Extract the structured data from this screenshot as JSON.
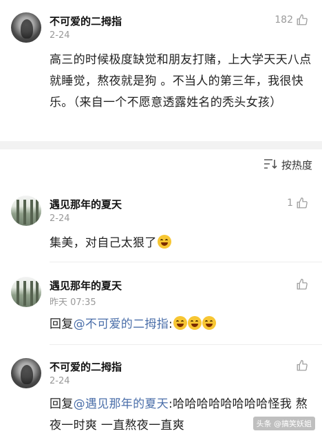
{
  "post": {
    "author": "不可爱的二拇指",
    "date": "2-24",
    "likes": "182",
    "content": "高三的时候极度缺觉和朋友打赌，上大学天天八点就睡觉，熬夜就是狗 。不当人的第三年，我很快乐。（来自一个不愿意透露姓名的秃头女孩）"
  },
  "sort": {
    "label": "按热度",
    "icon": "sort-icon"
  },
  "comments": [
    {
      "author": "遇见那年的夏天",
      "date": "2-24",
      "likes": "1",
      "text": "集美，对自己太狠了",
      "emoji_count": 1
    },
    {
      "author": "遇见那年的夏天",
      "date": "昨天 07:35",
      "likes": "",
      "prefix": "回复",
      "mention": "@不可爱的二拇指",
      "text": ":",
      "emoji_count": 3
    },
    {
      "author": "不可爱的二拇指",
      "date": "2-24",
      "likes": "",
      "prefix": "回复",
      "mention": "@遇见那年的夏天",
      "text": ":哈哈哈哈哈哈哈哈怪我 熬夜一时爽 一直熬夜一直爽"
    }
  ],
  "watermark": "头条 @搞笑妖姐"
}
